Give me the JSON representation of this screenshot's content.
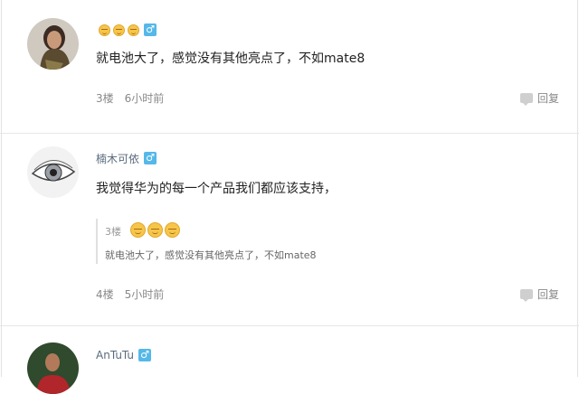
{
  "comments": [
    {
      "username": "",
      "text": "就电池大了，感觉没有其他亮点了，不如mate8",
      "floor": "3楼",
      "time": "6小时前",
      "reply_label": "回复"
    },
    {
      "username": "楠木可依",
      "text": "我觉得华为的每一个产品我们都应该支持，",
      "quote": {
        "floor": "3楼",
        "text": "就电池大了，感觉没有其他亮点了，不如mate8"
      },
      "floor": "4楼",
      "time": "5小时前",
      "reply_label": "回复"
    },
    {
      "username": "AnTuTu",
      "text": ""
    }
  ],
  "icons": {
    "gender": "male-icon",
    "reply": "comment-bubble-icon",
    "emoji": "smirk-emoji-icon"
  }
}
